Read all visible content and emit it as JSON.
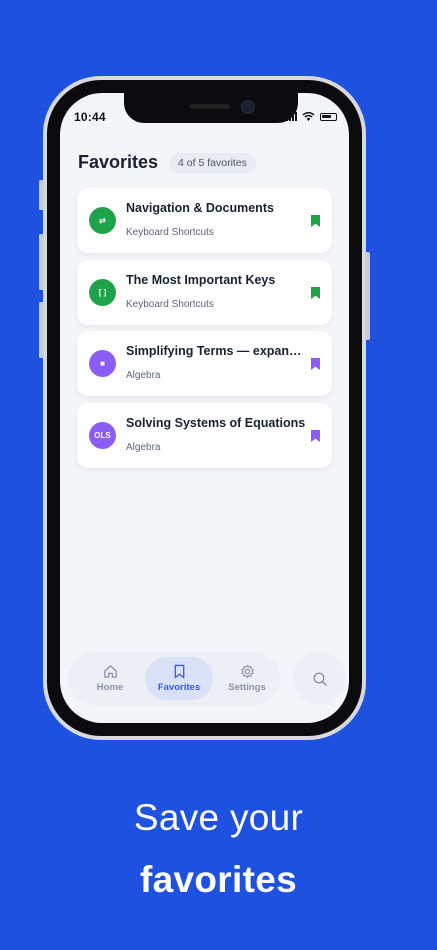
{
  "status_bar": {
    "time": "10:44"
  },
  "header": {
    "title": "Favorites",
    "count": "4 of 5 favorites"
  },
  "favorites": [
    {
      "title": "Navigation & Documents",
      "category": "Keyboard Shortcuts",
      "icon_text": "⇄",
      "color": "#1fa34a"
    },
    {
      "title": "The Most Important Keys",
      "category": "Keyboard Shortcuts",
      "icon_text": "[ ]",
      "color": "#1fa34a"
    },
    {
      "title": "Simplifying Terms — expanding",
      "category": "Algebra",
      "icon_text": "■",
      "color": "#8b5cf6"
    },
    {
      "title": "Solving Systems of Equations",
      "category": "Algebra",
      "icon_text": "OLS",
      "color": "#8b5cf6"
    }
  ],
  "tabbar": {
    "home": "Home",
    "favorites": "Favorites",
    "settings": "Settings",
    "active": "favorites"
  },
  "caption": {
    "line1": "Save your",
    "line2": "favorites"
  },
  "colors": {
    "background": "#1f51e0",
    "accent": "#3b5bd9",
    "green": "#1fa34a",
    "purple": "#8b5cf6"
  }
}
